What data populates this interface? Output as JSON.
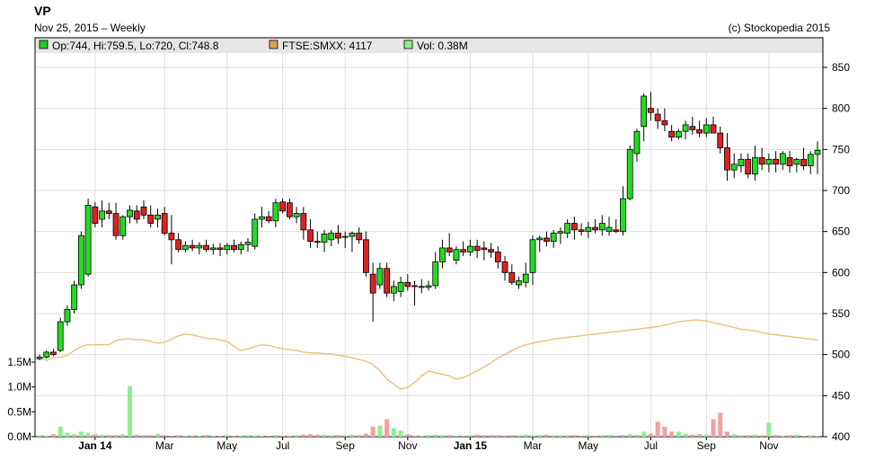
{
  "header": {
    "ticker": "VP",
    "date_line": "Nov 25, 2015 – Weekly",
    "credit": "(c) Stockopedia 2015"
  },
  "legend": [
    {
      "label": "Op:744, Hi:759.5, Lo:720, Cl:748.8",
      "color": "#22cc22"
    },
    {
      "label": "FTSE:SMXX: 4117",
      "color": "#d9a34a"
    },
    {
      "label": "Vol: 0.38M",
      "color": "#90ee90"
    }
  ],
  "colors": {
    "up": "#22dd22",
    "down": "#dd2222",
    "index_line": "#e8c07a",
    "vol_up": "#90ee90",
    "vol_down": "#f4a0a0",
    "vol_neutral": "#b0b0b0",
    "grid": "#dddddd",
    "legend_bg": "#e6e6e6"
  },
  "chart_data": {
    "type": "candlestick",
    "price_axis": {
      "min": 400,
      "max": 850,
      "ticks": [
        850,
        800,
        750,
        700,
        650,
        600,
        550,
        500,
        450,
        400
      ]
    },
    "volume_axis": {
      "ticks": [
        "1.5M",
        "1.0M",
        "0.5M",
        "0.0M"
      ],
      "values": [
        1.5,
        1.0,
        0.5,
        0.0
      ]
    },
    "x_labels": [
      "Jan 14",
      "Mar",
      "May",
      "Jul",
      "Sep",
      "Nov",
      "Jan 15",
      "Mar",
      "May",
      "Jul",
      "Sep",
      "Nov"
    ],
    "x_label_bold": [
      true,
      false,
      false,
      false,
      false,
      false,
      true,
      false,
      false,
      false,
      false,
      false
    ],
    "x_label_week_index": [
      8,
      18,
      27,
      35,
      44,
      53,
      62,
      71,
      79,
      88,
      96,
      105
    ],
    "grid_week_index": [
      8,
      18,
      27,
      35,
      44,
      53,
      62,
      71,
      79,
      88,
      96,
      105
    ],
    "candles": [
      [
        495,
        500,
        493,
        497
      ],
      [
        497,
        505,
        495,
        503
      ],
      [
        503,
        507,
        498,
        500
      ],
      [
        505,
        545,
        503,
        540
      ],
      [
        540,
        560,
        535,
        555
      ],
      [
        555,
        590,
        550,
        585
      ],
      [
        585,
        650,
        580,
        645
      ],
      [
        598,
        690,
        595,
        682
      ],
      [
        680,
        686,
        655,
        660
      ],
      [
        665,
        688,
        655,
        675
      ],
      [
        675,
        685,
        665,
        672
      ],
      [
        672,
        685,
        640,
        645
      ],
      [
        645,
        670,
        640,
        668
      ],
      [
        668,
        682,
        660,
        676
      ],
      [
        675,
        682,
        660,
        665
      ],
      [
        680,
        688,
        665,
        670
      ],
      [
        670,
        682,
        655,
        660
      ],
      [
        665,
        678,
        655,
        670
      ],
      [
        672,
        680,
        645,
        648
      ],
      [
        648,
        670,
        610,
        640
      ],
      [
        640,
        648,
        625,
        628
      ],
      [
        628,
        638,
        625,
        633
      ],
      [
        633,
        640,
        626,
        630
      ],
      [
        630,
        637,
        622,
        633
      ],
      [
        633,
        640,
        625,
        628
      ],
      [
        628,
        635,
        622,
        630
      ],
      [
        630,
        636,
        620,
        628
      ],
      [
        628,
        636,
        622,
        633
      ],
      [
        633,
        640,
        625,
        628
      ],
      [
        628,
        638,
        622,
        634
      ],
      [
        634,
        642,
        625,
        637
      ],
      [
        632,
        672,
        628,
        665
      ],
      [
        665,
        680,
        655,
        668
      ],
      [
        668,
        675,
        660,
        663
      ],
      [
        663,
        690,
        655,
        685
      ],
      [
        686,
        690,
        672,
        675
      ],
      [
        685,
        690,
        665,
        668
      ],
      [
        668,
        680,
        660,
        672
      ],
      [
        672,
        680,
        640,
        652
      ],
      [
        652,
        665,
        630,
        638
      ],
      [
        638,
        650,
        630,
        637
      ],
      [
        637,
        652,
        625,
        647
      ],
      [
        640,
        652,
        632,
        648
      ],
      [
        648,
        658,
        635,
        642
      ],
      [
        643,
        650,
        630,
        644
      ],
      [
        644,
        650,
        625,
        648
      ],
      [
        648,
        655,
        635,
        640
      ],
      [
        640,
        650,
        595,
        600
      ],
      [
        598,
        612,
        540,
        575
      ],
      [
        585,
        612,
        580,
        605
      ],
      [
        605,
        612,
        570,
        575
      ],
      [
        575,
        590,
        565,
        583
      ],
      [
        577,
        595,
        570,
        588
      ],
      [
        588,
        598,
        578,
        583
      ],
      [
        584,
        590,
        560,
        583
      ],
      [
        582,
        592,
        575,
        583
      ],
      [
        582,
        590,
        578,
        584
      ],
      [
        584,
        625,
        580,
        613
      ],
      [
        613,
        640,
        605,
        630
      ],
      [
        630,
        648,
        620,
        625
      ],
      [
        615,
        632,
        610,
        628
      ],
      [
        628,
        638,
        620,
        625
      ],
      [
        625,
        640,
        620,
        632
      ],
      [
        632,
        640,
        618,
        627
      ],
      [
        630,
        638,
        615,
        628
      ],
      [
        628,
        636,
        618,
        625
      ],
      [
        625,
        632,
        605,
        613
      ],
      [
        613,
        620,
        590,
        600
      ],
      [
        600,
        610,
        585,
        588
      ],
      [
        585,
        595,
        580,
        590
      ],
      [
        588,
        612,
        582,
        598
      ],
      [
        600,
        645,
        585,
        640
      ],
      [
        640,
        645,
        625,
        642
      ],
      [
        642,
        650,
        632,
        638
      ],
      [
        638,
        652,
        630,
        648
      ],
      [
        648,
        655,
        635,
        650
      ],
      [
        648,
        665,
        642,
        660
      ],
      [
        660,
        668,
        640,
        652
      ],
      [
        652,
        660,
        645,
        650
      ],
      [
        650,
        662,
        642,
        655
      ],
      [
        655,
        665,
        648,
        652
      ],
      [
        652,
        670,
        645,
        660
      ],
      [
        650,
        668,
        645,
        655
      ],
      [
        652,
        665,
        648,
        650
      ],
      [
        650,
        705,
        645,
        690
      ],
      [
        690,
        755,
        688,
        750
      ],
      [
        745,
        775,
        735,
        772
      ],
      [
        778,
        818,
        760,
        815
      ],
      [
        800,
        820,
        785,
        795
      ],
      [
        793,
        800,
        775,
        785
      ],
      [
        785,
        800,
        772,
        780
      ],
      [
        772,
        780,
        760,
        765
      ],
      [
        765,
        775,
        762,
        772
      ],
      [
        772,
        785,
        762,
        780
      ],
      [
        778,
        790,
        768,
        774
      ],
      [
        774,
        785,
        765,
        770
      ],
      [
        770,
        788,
        765,
        780
      ],
      [
        780,
        790,
        770,
        770
      ],
      [
        770,
        778,
        745,
        752
      ],
      [
        752,
        770,
        712,
        725
      ],
      [
        725,
        745,
        715,
        732
      ],
      [
        730,
        745,
        722,
        738
      ],
      [
        738,
        745,
        715,
        720
      ],
      [
        720,
        755,
        712,
        740
      ],
      [
        740,
        752,
        725,
        732
      ],
      [
        732,
        745,
        722,
        738
      ],
      [
        738,
        748,
        722,
        732
      ],
      [
        732,
        748,
        725,
        745
      ],
      [
        740,
        748,
        722,
        730
      ],
      [
        732,
        740,
        722,
        738
      ],
      [
        738,
        752,
        725,
        730
      ],
      [
        730,
        748,
        720,
        744
      ],
      [
        744,
        760,
        720,
        749
      ]
    ],
    "index_line": [
      497,
      493,
      496,
      497,
      499,
      505,
      510,
      512,
      512,
      512,
      512,
      517,
      519,
      519,
      518,
      518,
      516,
      514,
      515,
      519,
      523,
      525,
      524,
      522,
      520,
      519,
      518,
      516,
      510,
      505,
      507,
      510,
      512,
      511,
      509,
      507,
      506,
      505,
      503,
      502,
      502,
      501,
      501,
      499,
      498,
      496,
      494,
      492,
      488,
      480,
      470,
      464,
      458,
      460,
      466,
      474,
      480,
      478,
      476,
      474,
      470,
      472,
      476,
      480,
      485,
      490,
      496,
      500,
      505,
      509,
      512,
      514,
      516,
      517,
      519,
      520,
      521,
      522,
      523,
      524,
      525,
      526,
      527,
      528,
      529,
      530,
      531,
      532,
      533,
      534,
      536,
      538,
      540,
      541,
      542,
      542,
      541,
      539,
      537,
      535,
      533,
      531,
      530,
      529,
      527,
      525,
      524,
      523,
      522,
      521,
      520,
      519,
      518,
      517,
      516,
      515,
      516,
      517,
      517,
      517,
      517,
      517,
      517,
      517
    ],
    "volume": [
      0.03,
      0.02,
      0.05,
      0.2,
      0.08,
      0.05,
      0.1,
      0.08,
      0.05,
      0.04,
      0.03,
      0.03,
      0.05,
      1.02,
      0.04,
      0.03,
      0.03,
      0.06,
      0.03,
      0.02,
      0.03,
      0.02,
      0.02,
      0.02,
      0.03,
      0.02,
      0.02,
      0.03,
      0.02,
      0.02,
      0.03,
      0.02,
      0.02,
      0.02,
      0.03,
      0.02,
      0.02,
      0.03,
      0.04,
      0.05,
      0.04,
      0.04,
      0.03,
      0.03,
      0.03,
      0.04,
      0.03,
      0.06,
      0.2,
      0.22,
      0.35,
      0.17,
      0.12,
      0.05,
      0.02,
      0.02,
      0.03,
      0.04,
      0.03,
      0.03,
      0.02,
      0.02,
      0.03,
      0.04,
      0.03,
      0.03,
      0.03,
      0.02,
      0.03,
      0.03,
      0.04,
      0.03,
      0.03,
      0.04,
      0.03,
      0.03,
      0.03,
      0.03,
      0.02,
      0.03,
      0.02,
      0.03,
      0.04,
      0.02,
      0.03,
      0.05,
      0.04,
      0.1,
      0.06,
      0.3,
      0.2,
      0.1,
      0.1,
      0.06,
      0.04,
      0.05,
      0.04,
      0.35,
      0.48,
      0.1,
      0.05,
      0.03,
      0.03,
      0.04,
      0.03,
      0.28,
      0.03,
      0.02,
      0.03,
      0.04,
      0.02,
      0.03,
      0.02,
      0.03,
      0.03,
      0.02,
      0.38
    ],
    "volume_colors_override": {
      "83": "neutral",
      "84": "neutral"
    },
    "notes": "Weekly candlestick chart of VP with FTSE:SMXX index overlay line and weekly volume bars."
  }
}
